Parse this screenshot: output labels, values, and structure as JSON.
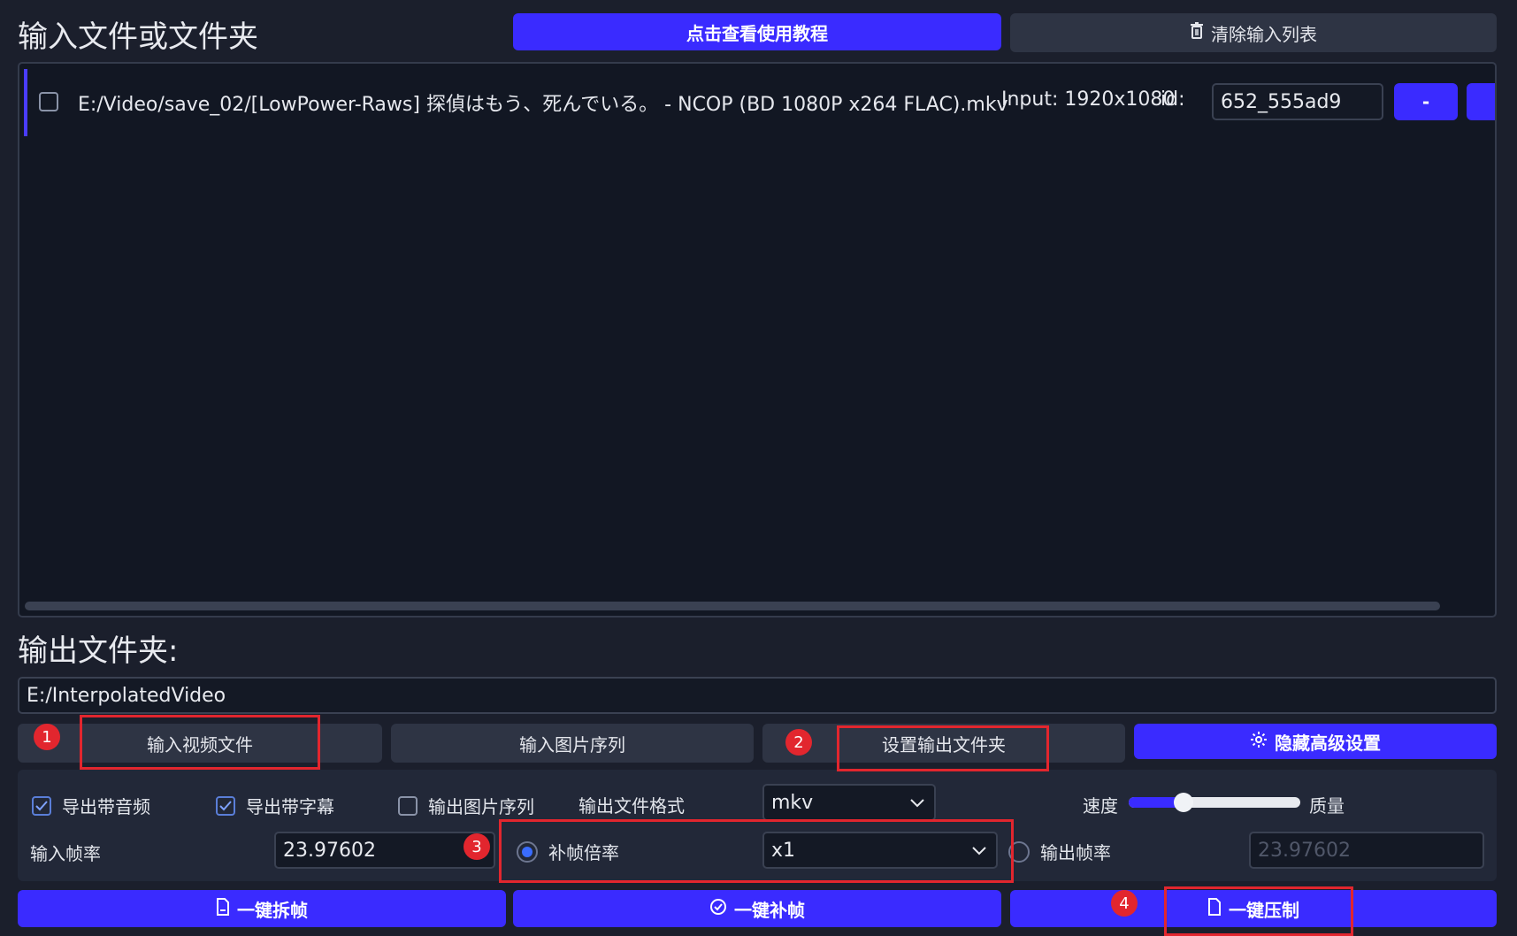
{
  "header": {
    "input_title": "输入文件或文件夹",
    "tutorial_button": "点击查看使用教程",
    "clear_button": "清除输入列表"
  },
  "file_list": {
    "items": [
      {
        "path": "E:/Video/save_02/[LowPower-Raws] 探偵はもう、死んでいる。 - NCOP (BD 1080P x264 FLAC).mkv",
        "resolution": "Input: 1920x1080",
        "id_label": "id:",
        "id_value": "652_555ad9",
        "remove_label": "-"
      }
    ]
  },
  "output": {
    "title": "输出文件夹:",
    "path": "E:/InterpolatedVideo"
  },
  "actions": {
    "input_video": "输入视频文件",
    "input_images": "输入图片序列",
    "set_output": "设置输出文件夹",
    "hide_advanced": "隐藏高级设置"
  },
  "settings": {
    "export_audio": "导出带音频",
    "export_subtitles": "导出带字幕",
    "output_image_seq": "输出图片序列",
    "output_format_label": "输出文件格式",
    "output_format_value": "mkv",
    "speed_label": "速度",
    "quality_label": "质量",
    "speed_quality_value": 0.32,
    "input_fps_label": "输入帧率",
    "input_fps_value": "23.97602",
    "interp_ratio_label": "补帧倍率",
    "interp_ratio_value": "x1",
    "output_fps_label": "输出帧率",
    "output_fps_placeholder": "23.97602"
  },
  "bottom": {
    "split_frames": "一键拆帧",
    "interpolate": "一键补帧",
    "compress": "一键压制"
  },
  "annotations": [
    "1",
    "2",
    "3",
    "4"
  ],
  "colors": {
    "background": "#1b1f2c",
    "accent_blue": "#3a2bff",
    "highlight_red": "#e2262e"
  }
}
